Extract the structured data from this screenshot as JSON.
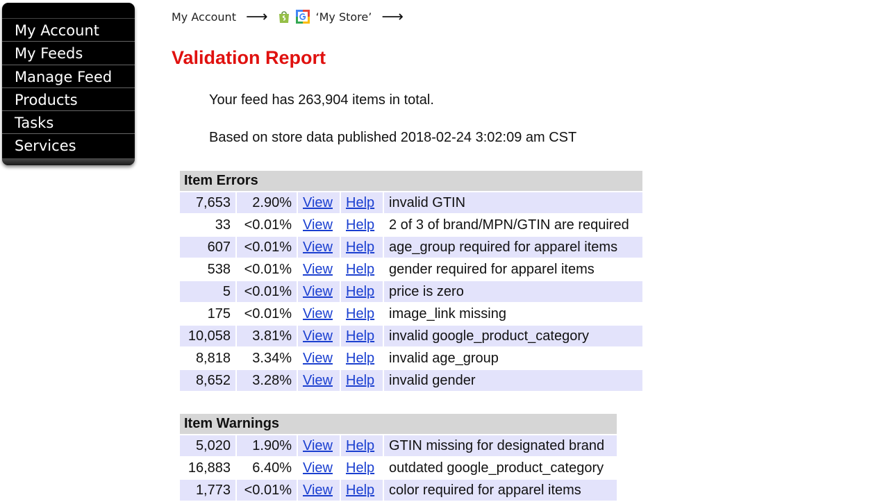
{
  "sidebar": {
    "items": [
      {
        "label": "My Account"
      },
      {
        "label": "My Feeds"
      },
      {
        "label": "Manage Feed"
      },
      {
        "label": "Products"
      },
      {
        "label": "Tasks"
      },
      {
        "label": "Services"
      }
    ]
  },
  "breadcrumb": {
    "account": "My Account",
    "store": "‘My Store’",
    "arrow": "⟶"
  },
  "page": {
    "title": "Validation Report",
    "total_text": "Your feed has 263,904 items in total.",
    "published_text": "Based on store data published 2018-02-24 3:02:09 am CST"
  },
  "errors": {
    "header": "Item Errors",
    "rows": [
      {
        "count": "7,653",
        "pct": "2.90%",
        "view": "View",
        "help": "Help",
        "desc": "invalid GTIN"
      },
      {
        "count": "33",
        "pct": "<0.01%",
        "view": "View",
        "help": "Help",
        "desc": "2 of 3 of brand/MPN/GTIN are required"
      },
      {
        "count": "607",
        "pct": "<0.01%",
        "view": "View",
        "help": "Help",
        "desc": "age_group required for apparel items"
      },
      {
        "count": "538",
        "pct": "<0.01%",
        "view": "View",
        "help": "Help",
        "desc": "gender required for apparel items"
      },
      {
        "count": "5",
        "pct": "<0.01%",
        "view": "View",
        "help": "Help",
        "desc": "price is zero"
      },
      {
        "count": "175",
        "pct": "<0.01%",
        "view": "View",
        "help": "Help",
        "desc": "image_link missing"
      },
      {
        "count": "10,058",
        "pct": "3.81%",
        "view": "View",
        "help": "Help",
        "desc": "invalid google_product_category"
      },
      {
        "count": "8,818",
        "pct": "3.34%",
        "view": "View",
        "help": "Help",
        "desc": "invalid age_group"
      },
      {
        "count": "8,652",
        "pct": "3.28%",
        "view": "View",
        "help": "Help",
        "desc": "invalid gender"
      }
    ]
  },
  "warnings": {
    "header": "Item Warnings",
    "rows": [
      {
        "count": "5,020",
        "pct": "1.90%",
        "view": "View",
        "help": "Help",
        "desc": "GTIN missing for designated brand"
      },
      {
        "count": "16,883",
        "pct": "6.40%",
        "view": "View",
        "help": "Help",
        "desc": "outdated google_product_category"
      },
      {
        "count": "1,773",
        "pct": "<0.01%",
        "view": "View",
        "help": "Help",
        "desc": "color required for apparel items"
      }
    ]
  },
  "colors": {
    "title": "#e0110f",
    "link": "#1a3fd0",
    "row_alt": "#e3e3fb",
    "header_bg": "#d6d6d6",
    "sidebar_bg": "#000000"
  },
  "icons": {
    "store_platform": "shopify-bag-icon",
    "merchant_center": "google-icon"
  }
}
